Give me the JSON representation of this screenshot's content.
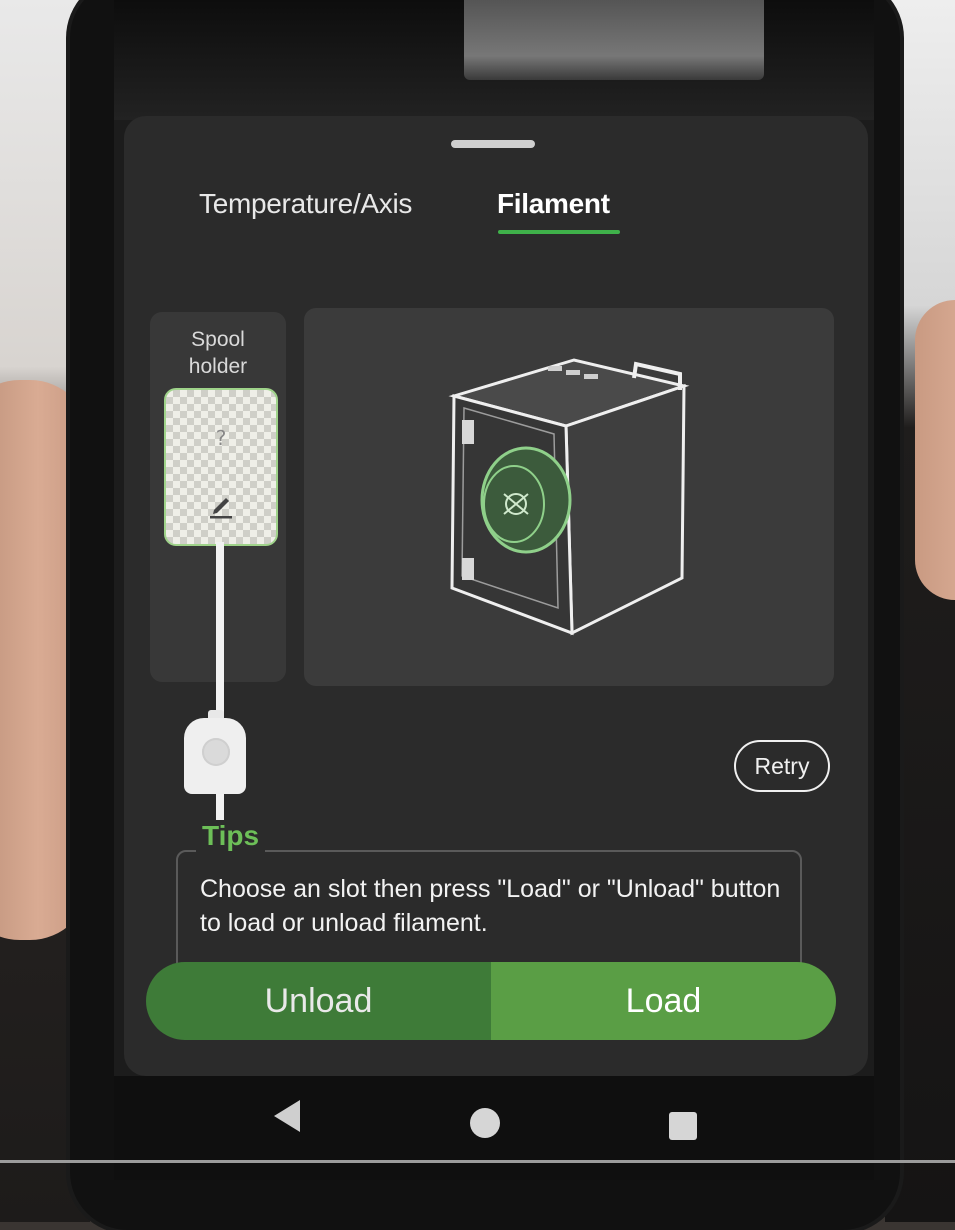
{
  "tabs": [
    {
      "label": "Temperature/Axis",
      "active": false
    },
    {
      "label": "Filament",
      "active": true
    }
  ],
  "spool_holder": {
    "title": "Spool\nholder",
    "slot_status": "?"
  },
  "printer_image": {
    "icon": "printer-with-spool-illustration"
  },
  "retry_label": "Retry",
  "tips": {
    "title": "Tips",
    "text": "Choose an slot then press \"Load\" or \"Unload\" button to load or unload filament."
  },
  "actions": {
    "unload_label": "Unload",
    "load_label": "Load"
  },
  "nav": {
    "back_icon": "back-triangle-icon",
    "home_icon": "home-circle-icon",
    "recent_icon": "recent-square-icon"
  },
  "colors": {
    "accent": "#3fb14a",
    "tips_title": "#6dbf58",
    "unload_bg": "#3e7b38",
    "load_bg": "#5a9e45"
  }
}
